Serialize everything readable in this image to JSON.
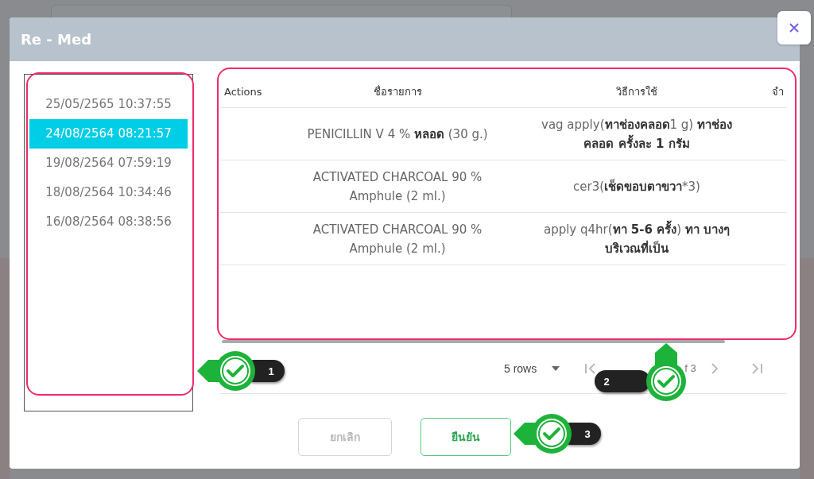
{
  "dialog": {
    "title": "Re - Med"
  },
  "history": [
    {
      "label": "25/05/2565 10:37:55",
      "selected": false
    },
    {
      "label": "24/08/2564 08:21:57",
      "selected": true
    },
    {
      "label": "19/08/2564 07:59:19",
      "selected": false
    },
    {
      "label": "18/08/2564 10:34:46",
      "selected": false
    },
    {
      "label": "16/08/2564 08:38:56",
      "selected": false
    }
  ],
  "table": {
    "columns": [
      "Actions",
      "ชื่อรายการ",
      "วิธีการใช้",
      "จำ"
    ],
    "rows": [
      {
        "name": "PENICILLIN V 4 % **หลอด** (30 g.)",
        "usage": "vag apply(**ทาช่องคลอด**1 g) **ทาช่องคลอด ครั้งละ 1 กรัม**"
      },
      {
        "name": "ACTIVATED CHARCOAL 90 % Amphule (2 ml.)",
        "usage": "cer3(**เช็ดขอบตาขวา***3)"
      },
      {
        "name": "ACTIVATED CHARCOAL 90 % Amphule (2 ml.)",
        "usage": "apply q4hr(**ทา 5-6 ครั้ง**) **ทา บางๆบริเวณที่เป็น**"
      }
    ]
  },
  "pagination": {
    "rows_per_page": "5 rows",
    "page_info": "f 3"
  },
  "buttons": [
    {
      "label": "ยกเลิก",
      "kind": "cancel"
    },
    {
      "label": "ยืนยัน",
      "kind": "confirm"
    }
  ],
  "annotations": [
    {
      "number": "1",
      "kind": "left"
    },
    {
      "number": "2",
      "kind": "up"
    },
    {
      "number": "3",
      "kind": "left"
    }
  ]
}
